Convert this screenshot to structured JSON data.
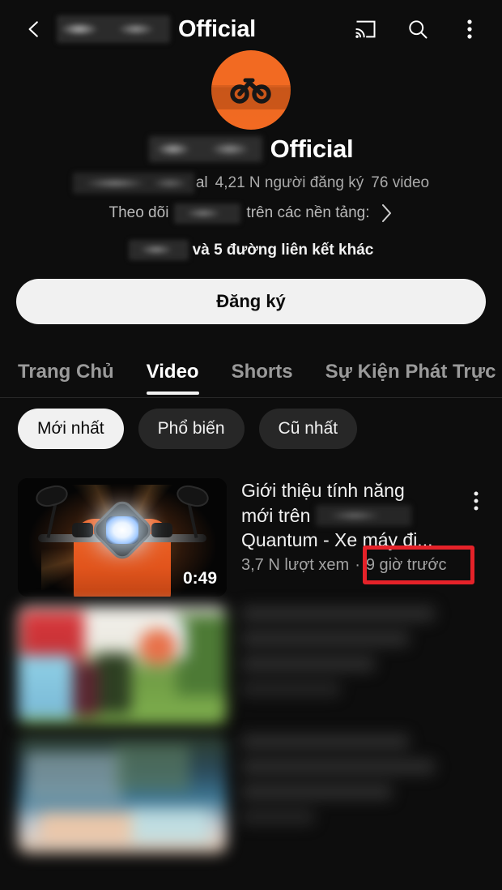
{
  "appbar": {
    "back_icon": "back-arrow-icon",
    "channel_name_redacted": "",
    "title": "Official",
    "cast_icon": "cast-icon",
    "search_icon": "search-icon",
    "overflow_icon": "more-vertical-icon"
  },
  "channel": {
    "avatar_icon": "channel-avatar-bike-logo",
    "avatar_color": "#f26a22",
    "name_redacted": "",
    "title": "Official",
    "handle_redacted": "",
    "handle_tail": "al",
    "subscribers": "4,21 N người đăng ký",
    "video_count": "76 video",
    "follow_prefix": "Theo dõi",
    "follow_suffix": "trên các nền tảng:",
    "follow_chevron_icon": "chevron-right-icon",
    "links_text": "và 5 đường liên kết khác",
    "subscribe_label": "Đăng ký"
  },
  "tabs": [
    {
      "label": "Trang Chủ",
      "active": false
    },
    {
      "label": "Video",
      "active": true
    },
    {
      "label": "Shorts",
      "active": false
    },
    {
      "label": "Sự Kiện Phát Trực",
      "active": false
    }
  ],
  "filter_chips": [
    {
      "label": "Mới nhất",
      "active": true
    },
    {
      "label": "Phổ biến",
      "active": false
    },
    {
      "label": "Cũ nhất",
      "active": false
    }
  ],
  "videos": [
    {
      "thumbnail": "orange-scooter-headlight-thumbnail",
      "duration": "0:49",
      "title_line1": "Giới thiệu tính năng",
      "title_line2_prefix": "mới trên",
      "title_line3": "Quantum - Xe máy đi...",
      "views": "3,7 N lượt xem",
      "separator": "·",
      "published": "9 giờ trước",
      "menu_icon": "more-vertical-icon"
    }
  ],
  "highlight": {
    "color": "#e52229",
    "target_text": "9 giờ trước"
  }
}
